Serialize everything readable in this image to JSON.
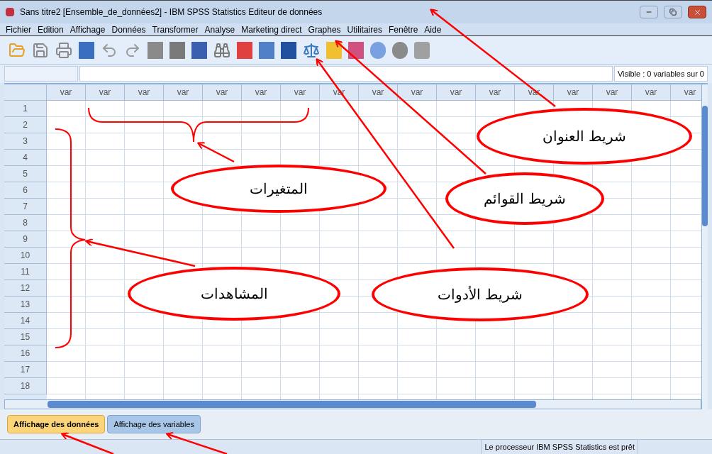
{
  "window": {
    "title": "Sans titre2 [Ensemble_de_données2] - IBM SPSS Statistics Editeur de données"
  },
  "menu": [
    "Fichier",
    "Edition",
    "Affichage",
    "Données",
    "Transformer",
    "Analyse",
    "Marketing direct",
    "Graphes",
    "Utilitaires",
    "Fenêtre",
    "Aide"
  ],
  "visible_info": "Visible : 0 variables sur 0",
  "grid": {
    "columns": [
      "var",
      "var",
      "var",
      "var",
      "var",
      "var",
      "var",
      "var",
      "var",
      "var",
      "var",
      "var",
      "var",
      "var",
      "var",
      "var",
      "var"
    ],
    "rows": [
      "1",
      "2",
      "3",
      "4",
      "5",
      "6",
      "7",
      "8",
      "9",
      "10",
      "11",
      "12",
      "13",
      "14",
      "15",
      "16",
      "17",
      "18"
    ]
  },
  "tabs": [
    {
      "label": "Affichage des données",
      "selected": true
    },
    {
      "label": "Affichage des variables",
      "selected": false
    }
  ],
  "status_bar": {
    "message": "Le processeur IBM SPSS Statistics  est prêt"
  },
  "callouts": [
    "شريط العنوان",
    "شريط القوائم",
    "المتغيرات",
    "المشاهدات",
    "شريط الأدوات"
  ]
}
